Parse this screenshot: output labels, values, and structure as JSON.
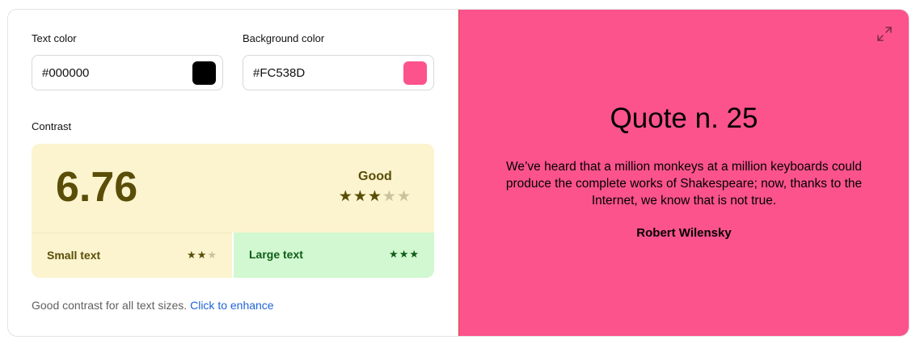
{
  "text_color": {
    "label": "Text color",
    "value": "#000000",
    "swatch": "#000000"
  },
  "background_color": {
    "label": "Background color",
    "value": "#FC538D",
    "swatch": "#FC538D"
  },
  "contrast": {
    "label": "Contrast",
    "score": "6.76",
    "rating": "Good",
    "rating_stars": 3,
    "rating_stars_max": 5,
    "small_text": {
      "label": "Small text",
      "stars": 2,
      "max": 3
    },
    "large_text": {
      "label": "Large text",
      "stars": 3,
      "max": 3
    }
  },
  "hint": {
    "text": "Good contrast for all text sizes.",
    "link": "Click to enhance"
  },
  "preview": {
    "title": "Quote n. 25",
    "quote": "We’ve heard that a million monkeys at a million keyboards could produce the complete works of Shakespeare; now, thanks to the Internet, we know that is not true.",
    "author": "Robert Wilensky",
    "expand_icon": "expand-icon"
  },
  "colors": {
    "score_text": "#5a4d08",
    "score_bg": "#fbf4cf",
    "large_bg": "#d1f8d0",
    "large_text": "#0f5c16",
    "link": "#1f63d8"
  }
}
